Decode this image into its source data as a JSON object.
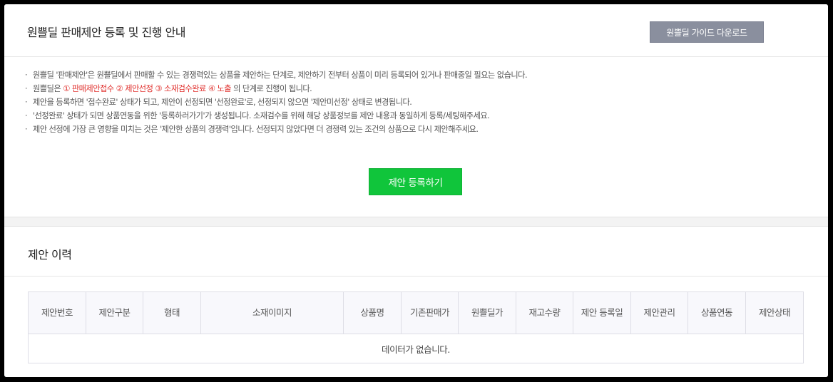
{
  "header": {
    "title": "원쁠딜 판매제안 등록 및 진행 안내",
    "guide_button": "원쁠딜 가이드 다운로드"
  },
  "notice": {
    "line1": "원쁠딜 '판매제안'은 원쁠딜에서 판매할 수 있는 경쟁력있는 상품을 제안하는 단계로, 제안하기 전부터 상품이 미리 등록되어 있거나 판매중일 필요는 없습니다.",
    "line2_prefix": "원쁠딜은 ",
    "line2_steps": "① 판매제안접수 ② 제안선정 ③ 소재검수완료 ④ 노출",
    "line2_suffix": " 의 단계로 진행이 됩니다.",
    "line3": "제안을 등록하면 '접수완료' 상태가 되고, 제안이 선정되면 '선정완료'로, 선정되지 않으면 '제안미선정' 상태로 변경됩니다.",
    "line4": "'선정완료' 상태가 되면 상품연동을 위한 '등록하러가기'가 생성됩니다. 소재검수를 위해 해당 상품정보를 제안 내용과 동일하게 등록/세팅해주세요.",
    "line5": "제안 선정에 가장 큰 영향을 미치는 것은 '제안한 상품의 경쟁력'입니다. 선정되지 않았다면 더 경쟁력 있는 조건의 상품으로 다시 제안해주세요."
  },
  "register_button": "제안 등록하기",
  "history": {
    "title": "제안 이력",
    "columns": [
      "제안번호",
      "제안구분",
      "형태",
      "소재이미지",
      "상품명",
      "기존판매가",
      "원쁠딜가",
      "재고수량",
      "제안 등록일",
      "제안관리",
      "상품연동",
      "제안상태"
    ],
    "empty_message": "데이터가 없습니다."
  },
  "colors": {
    "accent_green": "#10c53b",
    "highlight_red": "#e0302d",
    "guide_button_bg": "#8a8f9e"
  }
}
